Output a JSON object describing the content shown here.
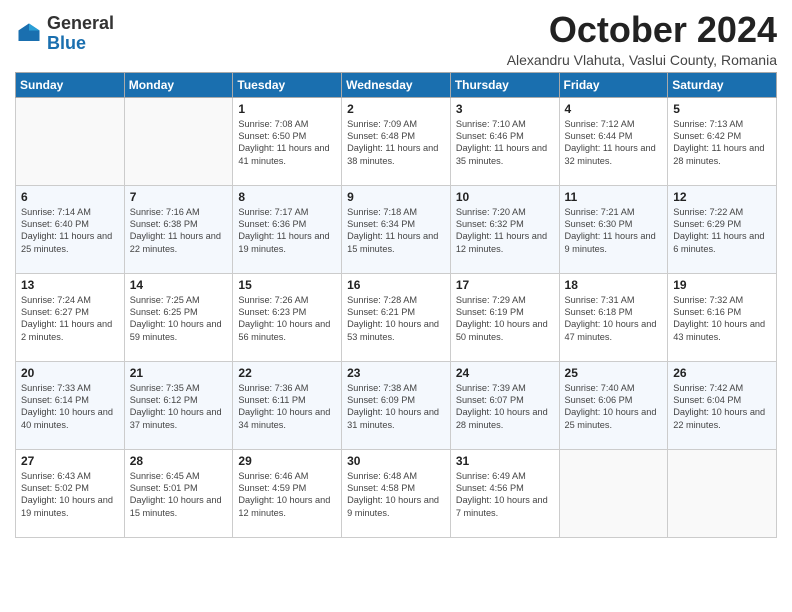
{
  "logo": {
    "general": "General",
    "blue": "Blue"
  },
  "title": {
    "month": "October 2024",
    "location": "Alexandru Vlahuta, Vaslui County, Romania"
  },
  "weekdays": [
    "Sunday",
    "Monday",
    "Tuesday",
    "Wednesday",
    "Thursday",
    "Friday",
    "Saturday"
  ],
  "weeks": [
    [
      {
        "day": "",
        "sunrise": "",
        "sunset": "",
        "daylight": ""
      },
      {
        "day": "",
        "sunrise": "",
        "sunset": "",
        "daylight": ""
      },
      {
        "day": "1",
        "sunrise": "Sunrise: 7:08 AM",
        "sunset": "Sunset: 6:50 PM",
        "daylight": "Daylight: 11 hours and 41 minutes."
      },
      {
        "day": "2",
        "sunrise": "Sunrise: 7:09 AM",
        "sunset": "Sunset: 6:48 PM",
        "daylight": "Daylight: 11 hours and 38 minutes."
      },
      {
        "day": "3",
        "sunrise": "Sunrise: 7:10 AM",
        "sunset": "Sunset: 6:46 PM",
        "daylight": "Daylight: 11 hours and 35 minutes."
      },
      {
        "day": "4",
        "sunrise": "Sunrise: 7:12 AM",
        "sunset": "Sunset: 6:44 PM",
        "daylight": "Daylight: 11 hours and 32 minutes."
      },
      {
        "day": "5",
        "sunrise": "Sunrise: 7:13 AM",
        "sunset": "Sunset: 6:42 PM",
        "daylight": "Daylight: 11 hours and 28 minutes."
      }
    ],
    [
      {
        "day": "6",
        "sunrise": "Sunrise: 7:14 AM",
        "sunset": "Sunset: 6:40 PM",
        "daylight": "Daylight: 11 hours and 25 minutes."
      },
      {
        "day": "7",
        "sunrise": "Sunrise: 7:16 AM",
        "sunset": "Sunset: 6:38 PM",
        "daylight": "Daylight: 11 hours and 22 minutes."
      },
      {
        "day": "8",
        "sunrise": "Sunrise: 7:17 AM",
        "sunset": "Sunset: 6:36 PM",
        "daylight": "Daylight: 11 hours and 19 minutes."
      },
      {
        "day": "9",
        "sunrise": "Sunrise: 7:18 AM",
        "sunset": "Sunset: 6:34 PM",
        "daylight": "Daylight: 11 hours and 15 minutes."
      },
      {
        "day": "10",
        "sunrise": "Sunrise: 7:20 AM",
        "sunset": "Sunset: 6:32 PM",
        "daylight": "Daylight: 11 hours and 12 minutes."
      },
      {
        "day": "11",
        "sunrise": "Sunrise: 7:21 AM",
        "sunset": "Sunset: 6:30 PM",
        "daylight": "Daylight: 11 hours and 9 minutes."
      },
      {
        "day": "12",
        "sunrise": "Sunrise: 7:22 AM",
        "sunset": "Sunset: 6:29 PM",
        "daylight": "Daylight: 11 hours and 6 minutes."
      }
    ],
    [
      {
        "day": "13",
        "sunrise": "Sunrise: 7:24 AM",
        "sunset": "Sunset: 6:27 PM",
        "daylight": "Daylight: 11 hours and 2 minutes."
      },
      {
        "day": "14",
        "sunrise": "Sunrise: 7:25 AM",
        "sunset": "Sunset: 6:25 PM",
        "daylight": "Daylight: 10 hours and 59 minutes."
      },
      {
        "day": "15",
        "sunrise": "Sunrise: 7:26 AM",
        "sunset": "Sunset: 6:23 PM",
        "daylight": "Daylight: 10 hours and 56 minutes."
      },
      {
        "day": "16",
        "sunrise": "Sunrise: 7:28 AM",
        "sunset": "Sunset: 6:21 PM",
        "daylight": "Daylight: 10 hours and 53 minutes."
      },
      {
        "day": "17",
        "sunrise": "Sunrise: 7:29 AM",
        "sunset": "Sunset: 6:19 PM",
        "daylight": "Daylight: 10 hours and 50 minutes."
      },
      {
        "day": "18",
        "sunrise": "Sunrise: 7:31 AM",
        "sunset": "Sunset: 6:18 PM",
        "daylight": "Daylight: 10 hours and 47 minutes."
      },
      {
        "day": "19",
        "sunrise": "Sunrise: 7:32 AM",
        "sunset": "Sunset: 6:16 PM",
        "daylight": "Daylight: 10 hours and 43 minutes."
      }
    ],
    [
      {
        "day": "20",
        "sunrise": "Sunrise: 7:33 AM",
        "sunset": "Sunset: 6:14 PM",
        "daylight": "Daylight: 10 hours and 40 minutes."
      },
      {
        "day": "21",
        "sunrise": "Sunrise: 7:35 AM",
        "sunset": "Sunset: 6:12 PM",
        "daylight": "Daylight: 10 hours and 37 minutes."
      },
      {
        "day": "22",
        "sunrise": "Sunrise: 7:36 AM",
        "sunset": "Sunset: 6:11 PM",
        "daylight": "Daylight: 10 hours and 34 minutes."
      },
      {
        "day": "23",
        "sunrise": "Sunrise: 7:38 AM",
        "sunset": "Sunset: 6:09 PM",
        "daylight": "Daylight: 10 hours and 31 minutes."
      },
      {
        "day": "24",
        "sunrise": "Sunrise: 7:39 AM",
        "sunset": "Sunset: 6:07 PM",
        "daylight": "Daylight: 10 hours and 28 minutes."
      },
      {
        "day": "25",
        "sunrise": "Sunrise: 7:40 AM",
        "sunset": "Sunset: 6:06 PM",
        "daylight": "Daylight: 10 hours and 25 minutes."
      },
      {
        "day": "26",
        "sunrise": "Sunrise: 7:42 AM",
        "sunset": "Sunset: 6:04 PM",
        "daylight": "Daylight: 10 hours and 22 minutes."
      }
    ],
    [
      {
        "day": "27",
        "sunrise": "Sunrise: 6:43 AM",
        "sunset": "Sunset: 5:02 PM",
        "daylight": "Daylight: 10 hours and 19 minutes."
      },
      {
        "day": "28",
        "sunrise": "Sunrise: 6:45 AM",
        "sunset": "Sunset: 5:01 PM",
        "daylight": "Daylight: 10 hours and 15 minutes."
      },
      {
        "day": "29",
        "sunrise": "Sunrise: 6:46 AM",
        "sunset": "Sunset: 4:59 PM",
        "daylight": "Daylight: 10 hours and 12 minutes."
      },
      {
        "day": "30",
        "sunrise": "Sunrise: 6:48 AM",
        "sunset": "Sunset: 4:58 PM",
        "daylight": "Daylight: 10 hours and 9 minutes."
      },
      {
        "day": "31",
        "sunrise": "Sunrise: 6:49 AM",
        "sunset": "Sunset: 4:56 PM",
        "daylight": "Daylight: 10 hours and 7 minutes."
      },
      {
        "day": "",
        "sunrise": "",
        "sunset": "",
        "daylight": ""
      },
      {
        "day": "",
        "sunrise": "",
        "sunset": "",
        "daylight": ""
      }
    ]
  ]
}
